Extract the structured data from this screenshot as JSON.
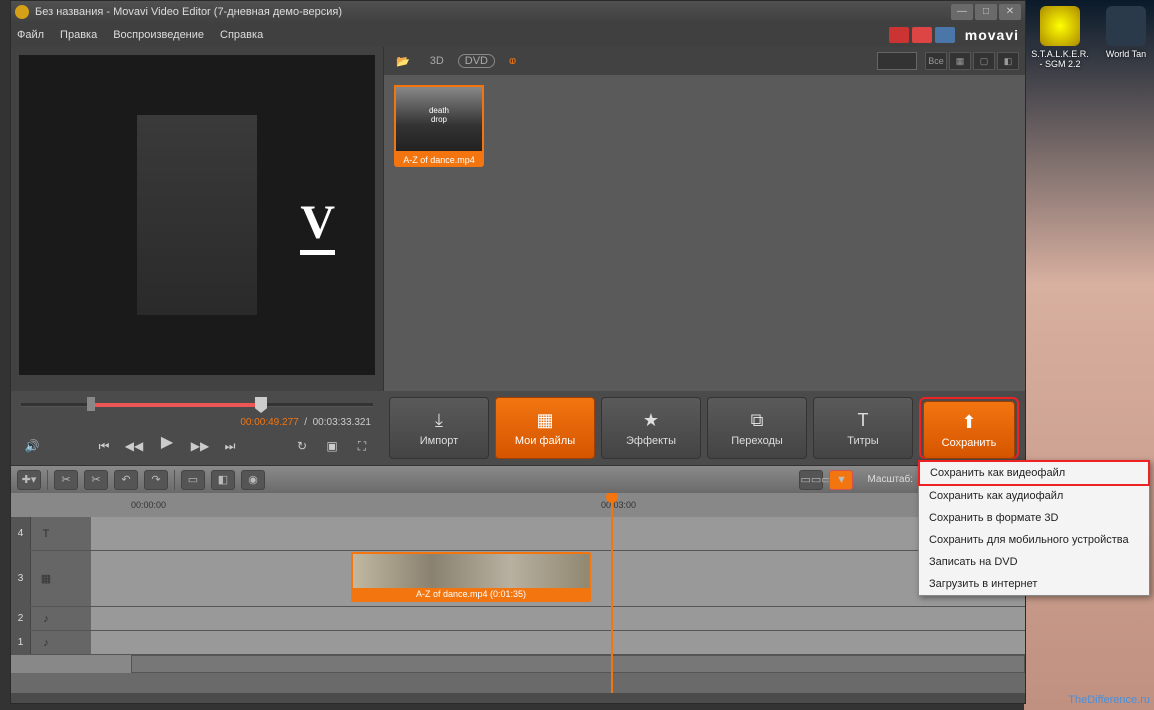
{
  "desktop": {
    "icons": [
      {
        "label": "S.T.A.L.K.E.R. - SGM 2.2"
      },
      {
        "label": "World Tan"
      }
    ],
    "watermark": "TheDifference.ru"
  },
  "titlebar": {
    "title": "Без названия - Movavi Video Editor (7-дневная демо-версия)"
  },
  "menu": {
    "items": [
      "Файл",
      "Правка",
      "Воспроизведение",
      "Справка"
    ],
    "logo": "movavi"
  },
  "media": {
    "toolbar": {
      "browse": "📂",
      "threeD": "3D",
      "dvd": "DVD"
    },
    "filter_all": "Все",
    "thumb": {
      "label": "A-Z of dance.mp4"
    }
  },
  "transport": {
    "current": "00:00:49.277",
    "total": "00:03:33.321"
  },
  "tabs": {
    "import": "Импорт",
    "files": "Мои файлы",
    "effects": "Эффекты",
    "transitions": "Переходы",
    "titles": "Титры",
    "save": "Сохранить"
  },
  "timeline": {
    "zoom_label": "Масштаб:",
    "ruler": {
      "t0": "00:00:00",
      "t1": "00:03:00"
    },
    "clip_label": "A-Z of dance.mp4 (0:01:35)",
    "tracks": [
      "4",
      "3",
      "2",
      "1"
    ]
  },
  "save_menu": {
    "items": [
      "Сохранить как видеофайл",
      "Сохранить как аудиофайл",
      "Сохранить в формате 3D",
      "Сохранить для мобильного устройства",
      "Записать на DVD",
      "Загрузить в интернет"
    ]
  }
}
